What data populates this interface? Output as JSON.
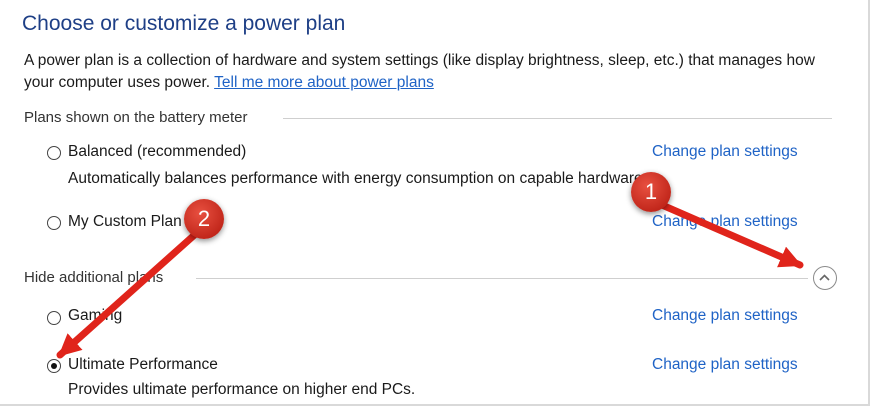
{
  "page": {
    "title": "Choose or customize a power plan",
    "description": "A power plan is a collection of hardware and system settings (like display brightness, sleep, etc.) that manages how your computer uses power.",
    "learn_more_link": "Tell me more about power plans"
  },
  "battery_meter_section": {
    "heading": "Plans shown on the battery meter",
    "plans": [
      {
        "name": "Balanced (recommended)",
        "description": "Automatically balances performance with energy consumption on capable hardware.",
        "change_link": "Change plan settings",
        "selected": false
      },
      {
        "name": "My Custom Plan",
        "description": "",
        "change_link": "Change plan settings",
        "selected": false
      }
    ]
  },
  "additional_section": {
    "heading": "Hide additional plans",
    "collapse_icon": "chevron-up-icon",
    "plans": [
      {
        "name": "Gaming",
        "description": "",
        "change_link": "Change plan settings",
        "selected": false
      },
      {
        "name": "Ultimate Performance",
        "description": "Provides ultimate performance on higher end PCs.",
        "change_link": "Change plan settings",
        "selected": true
      }
    ]
  },
  "annotations": {
    "badge_1": "1",
    "badge_2": "2",
    "arrow_color": "#e0241b"
  }
}
